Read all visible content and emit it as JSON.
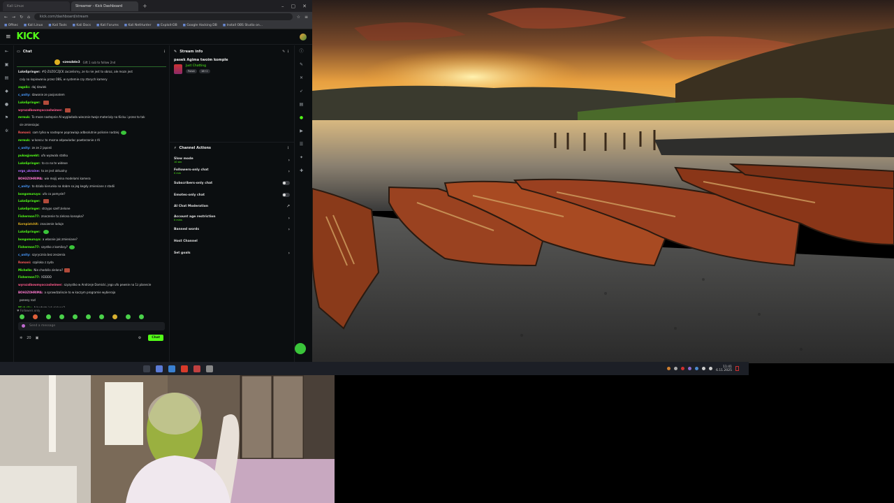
{
  "browser": {
    "tabs": [
      "Kali Linux",
      "Streamer - Kick Dashboard"
    ],
    "url": "kick.com/dashboard/stream",
    "bookmarks": [
      "Offsec",
      "Kali Linux",
      "Kali Tools",
      "Kali Docs",
      "Kali Forums",
      "Kali NetHunter",
      "Exploit-DB",
      "Google Hacking DB",
      "Install OBS Studio on..."
    ]
  },
  "kick": {
    "logo": "KICK",
    "chat": {
      "title": "Chat",
      "pinned_user": "c̶ze̶s̶dz̶i̶e̶3",
      "pinned_text": "Gift 1 sub to follow 2nd",
      "messages": [
        {
          "user": "LukeSpringer:",
          "text": "#Q-ZUZOCZJCK zaczelismy, ze to nie jest to obraz, ale mozn jest",
          "color": "#e8e8e8"
        },
        {
          "user": "",
          "text": "caly na kopiowaniu przez OBS, w systemie czy ztarych kamery",
          "color": "#e8e8e8"
        },
        {
          "user": "zagalic:",
          "text": "daj dzwiek",
          "color": "#53fc18"
        },
        {
          "user": "c_unity:",
          "text": "dzwonie ze pasjonatem",
          "color": "#4a9bff"
        },
        {
          "user": "LukeSpringer:",
          "text": "",
          "color": "#53fc18",
          "emoji": "r"
        },
        {
          "user": "wyrozalbowmyoccasheimer:",
          "text": "",
          "color": "#ff5a8c",
          "emoji": "r"
        },
        {
          "user": "mrmuk:",
          "text": "To moze nastepnie AI wygladada wiecznie twoje materialy na Kicku i przez to tak",
          "color": "#53fc18"
        },
        {
          "user": "",
          "text": "sie zmieniajac",
          "color": "#e8e8e8"
        },
        {
          "user": "Romani:",
          "text": "sam tylko w nastepne poprawiaja adbsolutnie polisnie nadziej",
          "color": "#ff5a5a",
          "emoji": "g"
        },
        {
          "user": "mrmuk:",
          "text": "w koncu: to mozna odpowiadac powtarzanie z AI",
          "color": "#53fc18"
        },
        {
          "user": "c_unity:",
          "text": "ze ze 2 japonii",
          "color": "#4a9bff"
        },
        {
          "user": "pukoqjowebt:",
          "text": "ufo wyzwala statku",
          "color": "#53fc18"
        },
        {
          "user": "LukeSpringer:",
          "text": "to co na te wideoe",
          "color": "#53fc18"
        },
        {
          "user": "ergo_ukraine:",
          "text": "to ze jest aktualny",
          "color": "#b36bff"
        },
        {
          "user": "BOH3ZOHRIMA:",
          "text": "wie mojij wina modelami kamera",
          "color": "#ff7ad0"
        },
        {
          "user": "c_unity:",
          "text": "to dziala kierunka na dobre sa jeg kegdy zmieniane z stadii",
          "color": "#4a9bff"
        },
        {
          "user": "bongomuruyo:",
          "text": "ufo co pomysle?",
          "color": "#53fc18"
        },
        {
          "user": "LukeSpringer:",
          "text": "",
          "color": "#53fc18",
          "emoji": "r"
        },
        {
          "user": "LukeSpringer:",
          "text": "strzypo szelf zielone",
          "color": "#53fc18"
        },
        {
          "user": "Fisherman77:",
          "text": "znaczenie to zielona kanapka?",
          "color": "#53fc18"
        },
        {
          "user": "Kornpiatchlt:",
          "text": "znaczenie laduje",
          "color": "#e0b020"
        },
        {
          "user": "LukeSpringer:",
          "text": "",
          "color": "#53fc18",
          "emoji": "g"
        },
        {
          "user": "bongomuruyo:",
          "text": "a wlasnie jak zmieniane?",
          "color": "#53fc18"
        },
        {
          "user": "Fisherman77:",
          "text": "szystko z komiksy?",
          "color": "#53fc18",
          "emoji": "g"
        },
        {
          "user": "c_unity:",
          "text": "szyrycznia bez zeszenia",
          "color": "#4a9bff"
        },
        {
          "user": "Romani:",
          "text": "szpiloka z zyda",
          "color": "#ff5a5a"
        },
        {
          "user": "Michelle:",
          "text": "Nie chodzilo zielono?",
          "color": "#53fc18",
          "emoji": "r"
        },
        {
          "user": "Fisherman77:",
          "text": "XDDDD",
          "color": "#53fc18"
        },
        {
          "user": "wyrozalbowmyoccasheimer:",
          "text": "szyzystko w Andrzeje Domicki, jego ufo pewnie na 1z planecie",
          "color": "#ff5a8c"
        },
        {
          "user": "BOH3ZOHRIMA:",
          "text": "a sprawdzaliscie to w kaczym programie wybieraja",
          "color": "#ff7ad0"
        },
        {
          "user": "",
          "text": "ponesy rozl",
          "color": "#e8e8e8"
        },
        {
          "user": "Michelle:",
          "text": "A herbata jak zielona?",
          "color": "#53fc18"
        }
      ],
      "followers_label": "Followers only",
      "input_placeholder": "Send a message",
      "counter": "20",
      "send_label": "Chat"
    },
    "stream_info": {
      "title": "Stream info",
      "stream_title": "pasek Agima twoim komple",
      "category": "Just Chatting",
      "tags": [
        "Polski",
        "18+2"
      ]
    },
    "channel_actions": {
      "title": "Channel Actions",
      "items": [
        {
          "label": "Slow mode",
          "sub": "10 sec",
          "control": "chevron"
        },
        {
          "label": "Followers-only chat",
          "sub": "0 min",
          "control": "chevron"
        },
        {
          "label": "Subscribers-only chat",
          "sub": "",
          "control": "toggle"
        },
        {
          "label": "Emotes-only chat",
          "sub": "",
          "control": "toggle"
        },
        {
          "label": "AI Chat Moderation",
          "sub": "",
          "control": "external"
        },
        {
          "label": "Account age restriction",
          "sub": "0 mins",
          "control": "chevron"
        },
        {
          "label": "Banned words",
          "sub": "",
          "control": "chevron"
        },
        {
          "label": "Host Channel",
          "sub": "",
          "control": "none"
        },
        {
          "label": "Set goals",
          "sub": "",
          "control": "chevron"
        }
      ]
    }
  },
  "taskbar": {
    "time": "11:41",
    "date": "6.11.2025"
  },
  "colors": {
    "kick_green": "#53fc18",
    "panel_bg": "#0b0e10"
  }
}
